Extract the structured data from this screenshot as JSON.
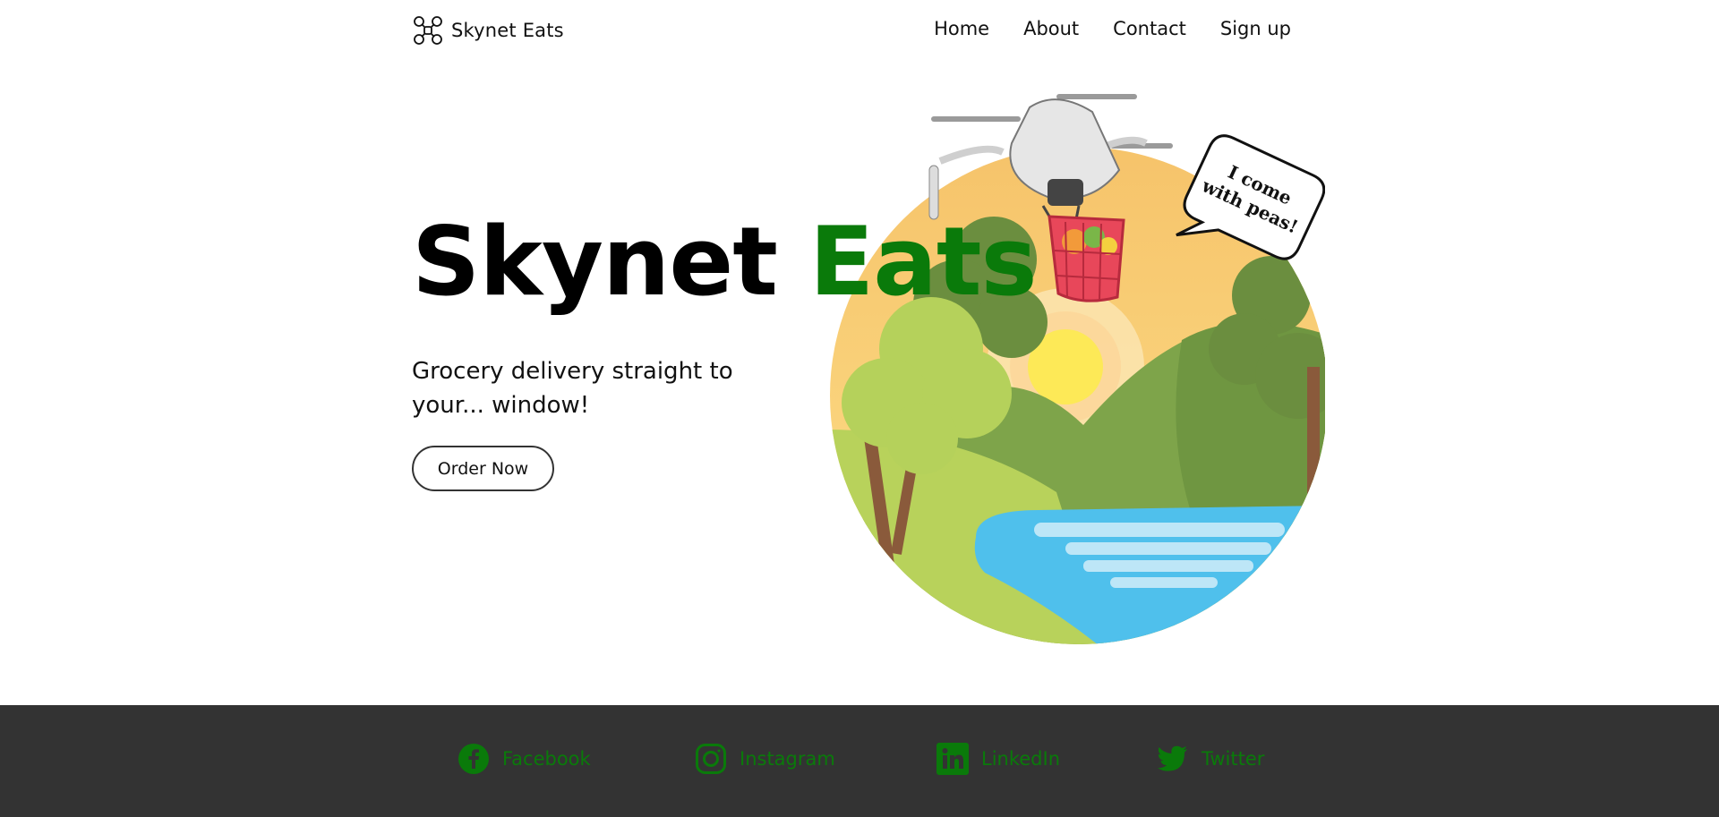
{
  "brand": {
    "name": "Skynet Eats",
    "logo_icon": "drone-icon"
  },
  "nav": {
    "items": [
      {
        "label": "Home"
      },
      {
        "label": "About"
      },
      {
        "label": "Contact"
      },
      {
        "label": "Sign up"
      }
    ]
  },
  "hero": {
    "title_part1": "Skynet",
    "title_part2": "Eats",
    "tagline": "Grocery delivery straight to your... window!",
    "cta_label": "Order Now",
    "speech_line1": "I come",
    "speech_line2": "with peas!"
  },
  "footer": {
    "social": [
      {
        "label": "Facebook",
        "icon": "facebook-icon"
      },
      {
        "label": "Instagram",
        "icon": "instagram-icon"
      },
      {
        "label": "LinkedIn",
        "icon": "linkedin-icon"
      },
      {
        "label": "Twitter",
        "icon": "twitter-icon"
      }
    ]
  },
  "colors": {
    "accent_green": "#0a7a0a",
    "footer_bg": "#333333",
    "text": "#111111"
  }
}
